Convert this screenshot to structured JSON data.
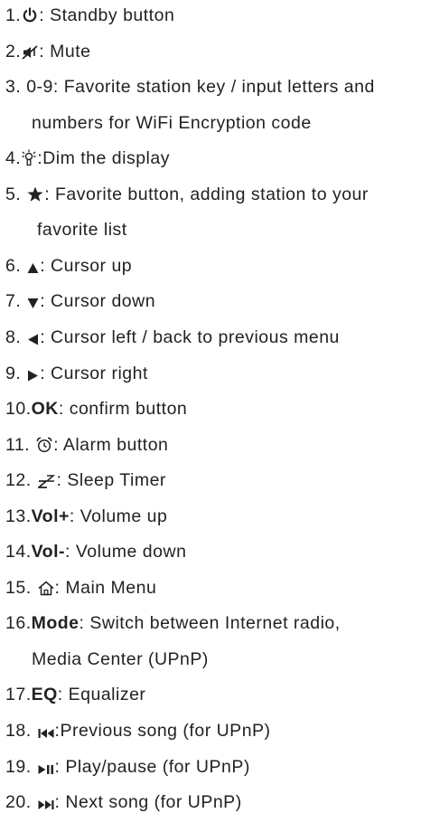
{
  "items": [
    {
      "num": "1.",
      "key": "",
      "text": ": Standby button",
      "icon": "power-icon"
    },
    {
      "num": "2.",
      "key": "",
      "text": ": Mute",
      "icon": "mute-icon"
    },
    {
      "num": "3. ",
      "key": "",
      "text": "0-9: Favorite station key / input letters and",
      "text2": "numbers for WiFi Encryption code",
      "icon": ""
    },
    {
      "num": "4.",
      "key": "",
      "text": ":Dim the display",
      "icon": "dim-icon"
    },
    {
      "num": "5. ",
      "key": "",
      "text": ": Favorite button, adding station to your",
      "text2": "favorite list",
      "icon": "star-icon"
    },
    {
      "num": "6. ",
      "key": "",
      "text": ": Cursor up",
      "icon": "triangle-up-icon"
    },
    {
      "num": "7. ",
      "key": "",
      "text": ": Cursor down",
      "icon": "triangle-down-icon"
    },
    {
      "num": "8. ",
      "key": "",
      "text": ": Cursor left / back to previous menu",
      "icon": "triangle-left-icon"
    },
    {
      "num": "9. ",
      "key": "",
      "text": ": Cursor right",
      "icon": "triangle-right-icon"
    },
    {
      "num": "10.",
      "key": "OK",
      "text": ": confirm button",
      "icon": ""
    },
    {
      "num": "11. ",
      "key": "",
      "text": ": Alarm button",
      "icon": "alarm-clock-icon"
    },
    {
      "num": "12. ",
      "key": "",
      "text": ": Sleep Timer",
      "icon": "sleep-icon"
    },
    {
      "num": "13.",
      "key": "Vol+",
      "text": ": Volume up",
      "icon": ""
    },
    {
      "num": "14.",
      "key": "Vol-",
      "text": ": Volume down",
      "icon": ""
    },
    {
      "num": "15. ",
      "key": "",
      "text": ": Main Menu",
      "icon": "home-icon"
    },
    {
      "num": "16.",
      "key": "Mode",
      "text": ": Switch between Internet radio,",
      "text2": "Media Center (UPnP)",
      "icon": ""
    },
    {
      "num": "17.",
      "key": "EQ",
      "text": ": Equalizer",
      "icon": ""
    },
    {
      "num": "18. ",
      "key": "",
      "text": ":Previous song (for UPnP)",
      "icon": "previous-track-icon"
    },
    {
      "num": "19. ",
      "key": "",
      "text": ": Play/pause (for UPnP)",
      "icon": "play-pause-icon"
    },
    {
      "num": "20. ",
      "key": "",
      "text": ": Next song (for UPnP)",
      "icon": "next-track-icon"
    }
  ]
}
